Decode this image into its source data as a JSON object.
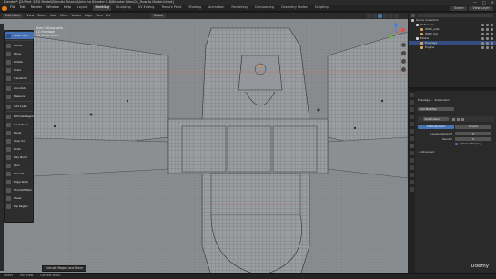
{
  "window": {
    "title": "Blender* [D:\\Part 3\\3D Model\\Blender Tutorial\\Intro to Blender 2.8\\Blender Files\\04_How to Model.blend]",
    "controls": [
      "—",
      "□",
      "✕"
    ]
  },
  "menubar": {
    "menus": [
      "File",
      "Edit",
      "Render",
      "Window",
      "Help"
    ],
    "workspaces": [
      "Layout",
      "Modeling",
      "Sculpting",
      "UV Editing",
      "Texture Paint",
      "Shading",
      "Animation",
      "Rendering",
      "Compositing",
      "Geometry Nodes",
      "Scripting"
    ],
    "active_workspace": "Modeling",
    "scene": "Scene",
    "view_layer": "View Layer"
  },
  "viewport_header": {
    "mode": "Edit Mode",
    "items": [
      "View",
      "Select",
      "Add",
      "Mesh",
      "Vertex",
      "Edge",
      "Face",
      "UV"
    ],
    "transform_orientation": "Global"
  },
  "viewport_info": {
    "lines": [
      "User Orthographic",
      "(1) Fuselage",
      "10 Centimeters"
    ]
  },
  "tools": [
    {
      "label": "Select Box",
      "icon": "select-box-icon",
      "selected": true
    },
    {
      "label": "Cursor",
      "icon": "cursor-icon"
    },
    {
      "label": "Move",
      "icon": "move-icon"
    },
    {
      "label": "Rotate",
      "icon": "rotate-icon"
    },
    {
      "label": "Scale",
      "icon": "scale-icon"
    },
    {
      "label": "Transform",
      "icon": "transform-icon"
    },
    {
      "label": "Annotate",
      "icon": "annotate-icon"
    },
    {
      "label": "Measure",
      "icon": "measure-icon"
    },
    {
      "label": "Add Cube",
      "icon": "add-cube-icon"
    },
    {
      "label": "Extrude Region",
      "icon": "extrude-icon"
    },
    {
      "label": "Inset Faces",
      "icon": "inset-icon"
    },
    {
      "label": "Bevel",
      "icon": "bevel-icon"
    },
    {
      "label": "Loop Cut",
      "icon": "loop-cut-icon"
    },
    {
      "label": "Knife",
      "icon": "knife-icon"
    },
    {
      "label": "Poly Build",
      "icon": "poly-build-icon"
    },
    {
      "label": "Spin",
      "icon": "spin-icon"
    },
    {
      "label": "Smooth",
      "icon": "smooth-icon"
    },
    {
      "label": "Edge Slide",
      "icon": "edge-slide-icon"
    },
    {
      "label": "Shrink/Fatten",
      "icon": "shrink-fatten-icon"
    },
    {
      "label": "Shear",
      "icon": "shear-icon"
    },
    {
      "label": "Rip Region",
      "icon": "rip-region-icon"
    }
  ],
  "outliner": {
    "search_placeholder": "",
    "rows": [
      {
        "label": "Scene Collection",
        "indent": 0,
        "color": "#bdbdbd"
      },
      {
        "label": "Reference",
        "indent": 1,
        "color": "#d8d8d8"
      },
      {
        "label": "WW2_side",
        "indent": 2,
        "color": "#e0a458"
      },
      {
        "label": "WW2_top",
        "indent": 2,
        "color": "#e0a458"
      },
      {
        "label": "Model",
        "indent": 1,
        "color": "#d8d8d8"
      },
      {
        "label": "Fuselage",
        "indent": 2,
        "color": "#e0a458",
        "selected": true
      },
      {
        "label": "Engine",
        "indent": 2,
        "color": "#e0a458"
      }
    ]
  },
  "properties": {
    "object_name": "Fuselage",
    "modifier_menu": "Add Modifier",
    "modifier": {
      "name": "Subdivision",
      "tabs": [
        "Catmull-Clark",
        "Simple"
      ],
      "active_tab": "Catmull-Clark",
      "levels_viewport_label": "Levels Viewport",
      "levels_viewport": "2",
      "render_label": "Render",
      "render": "2",
      "optimal_display_label": "Optimal Display",
      "advanced_label": "Advanced"
    },
    "header_labels": [
      "Fuselage",
      "Subdivision"
    ]
  },
  "statusbar": {
    "items": [
      "Select",
      "Pan View",
      "Context Menu",
      "Extrude Region and Move"
    ],
    "watermark": "Udemy"
  },
  "colors": {
    "accent": "#4772b3",
    "viewport_bg": "#8a8d90",
    "wire": "#3a3c3f",
    "red_edge": "#c86a6a"
  }
}
